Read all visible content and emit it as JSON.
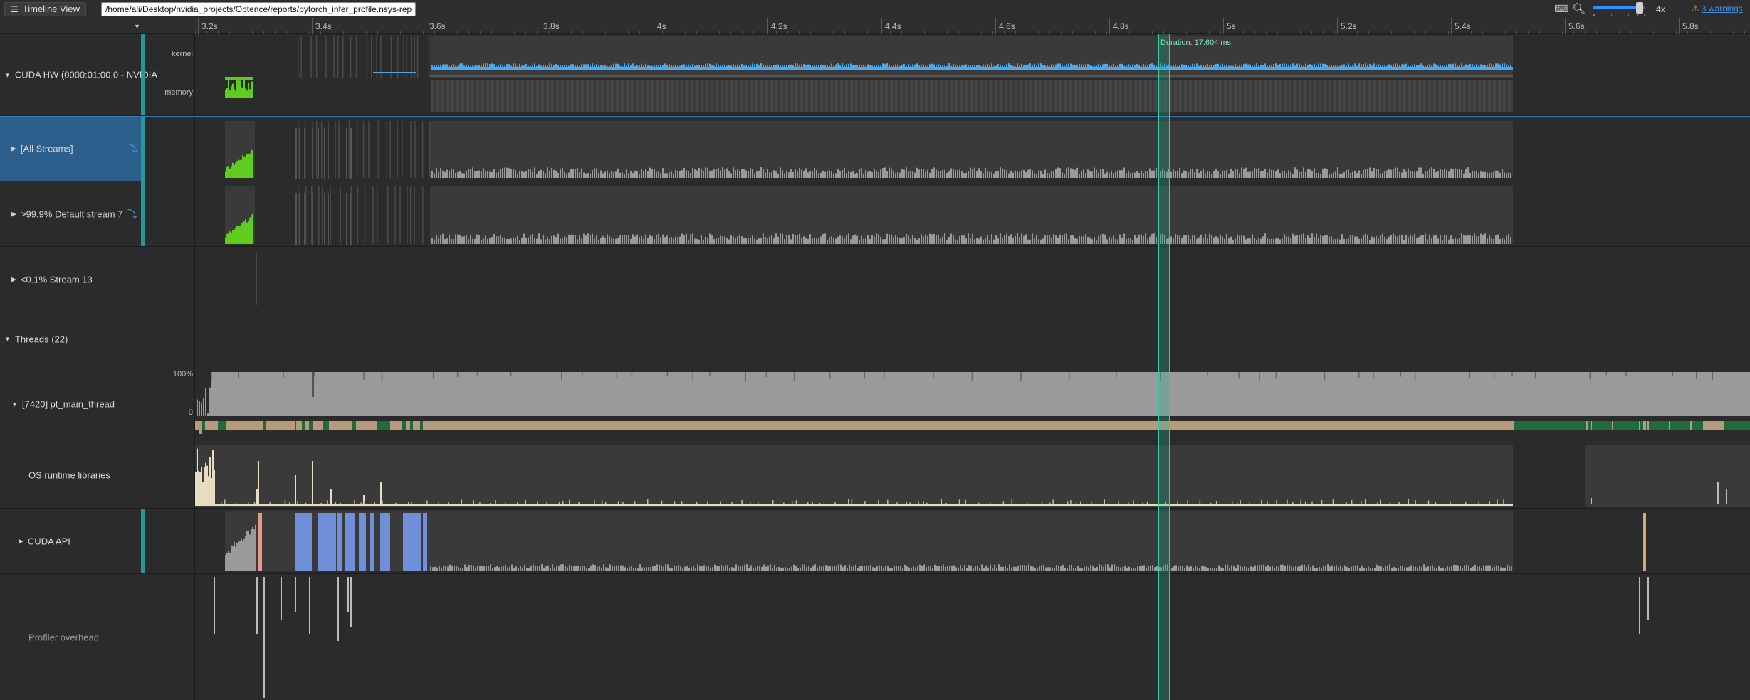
{
  "toolbar": {
    "view_button": "Timeline View",
    "report_path": "/home/ali/Desktop/nvidia_projects/Optence/reports/pytorch_infer_profile.nsys-rep",
    "zoom_level": "4x",
    "warnings": "3 warnings",
    "colors": {
      "slider": "#2f8fff",
      "warning": "#f0a030",
      "link": "#3f8fe8"
    }
  },
  "ruler": {
    "ticks": [
      "3.2s",
      "3.4s",
      "3.6s",
      "3.8s",
      "4s",
      "4.2s",
      "4.4s",
      "4.6s",
      "4.8s",
      "5s",
      "5.2s",
      "5.4s",
      "5.6s",
      "5.8s"
    ]
  },
  "selection": {
    "duration_label": "Duration: 17.604 ms",
    "color": "#2fd0a0"
  },
  "rows": {
    "cuda_hw": {
      "label": "CUDA HW (0000:01:00.0 - NVIDIA",
      "sub_kernel": "kernel",
      "sub_memory": "memory"
    },
    "all_streams": {
      "label": "[All Streams]"
    },
    "default_stream": {
      "label": ">99.9% Default stream 7"
    },
    "stream13": {
      "label": "<0.1% Stream 13"
    },
    "threads": {
      "label": "Threads (22)"
    },
    "main_thread": {
      "label": "[7420] pt_main_thread",
      "axis_top": "100%",
      "axis_bottom": "0"
    },
    "os_runtime": {
      "label": "OS runtime libraries"
    },
    "cuda_api": {
      "label": "CUDA API"
    },
    "profiler_overhead": {
      "label": "Profiler overhead"
    }
  },
  "colors": {
    "kernel": "#4fa7e8",
    "memory": "#5fcc20",
    "activity": "#9a9a9a",
    "thread_state": "#b59a7c",
    "thread_running": "#1f6b3a",
    "cuda_api": "#6f8fd8",
    "osrt": "#e8dcc0",
    "teal": "#1f9aa0"
  }
}
